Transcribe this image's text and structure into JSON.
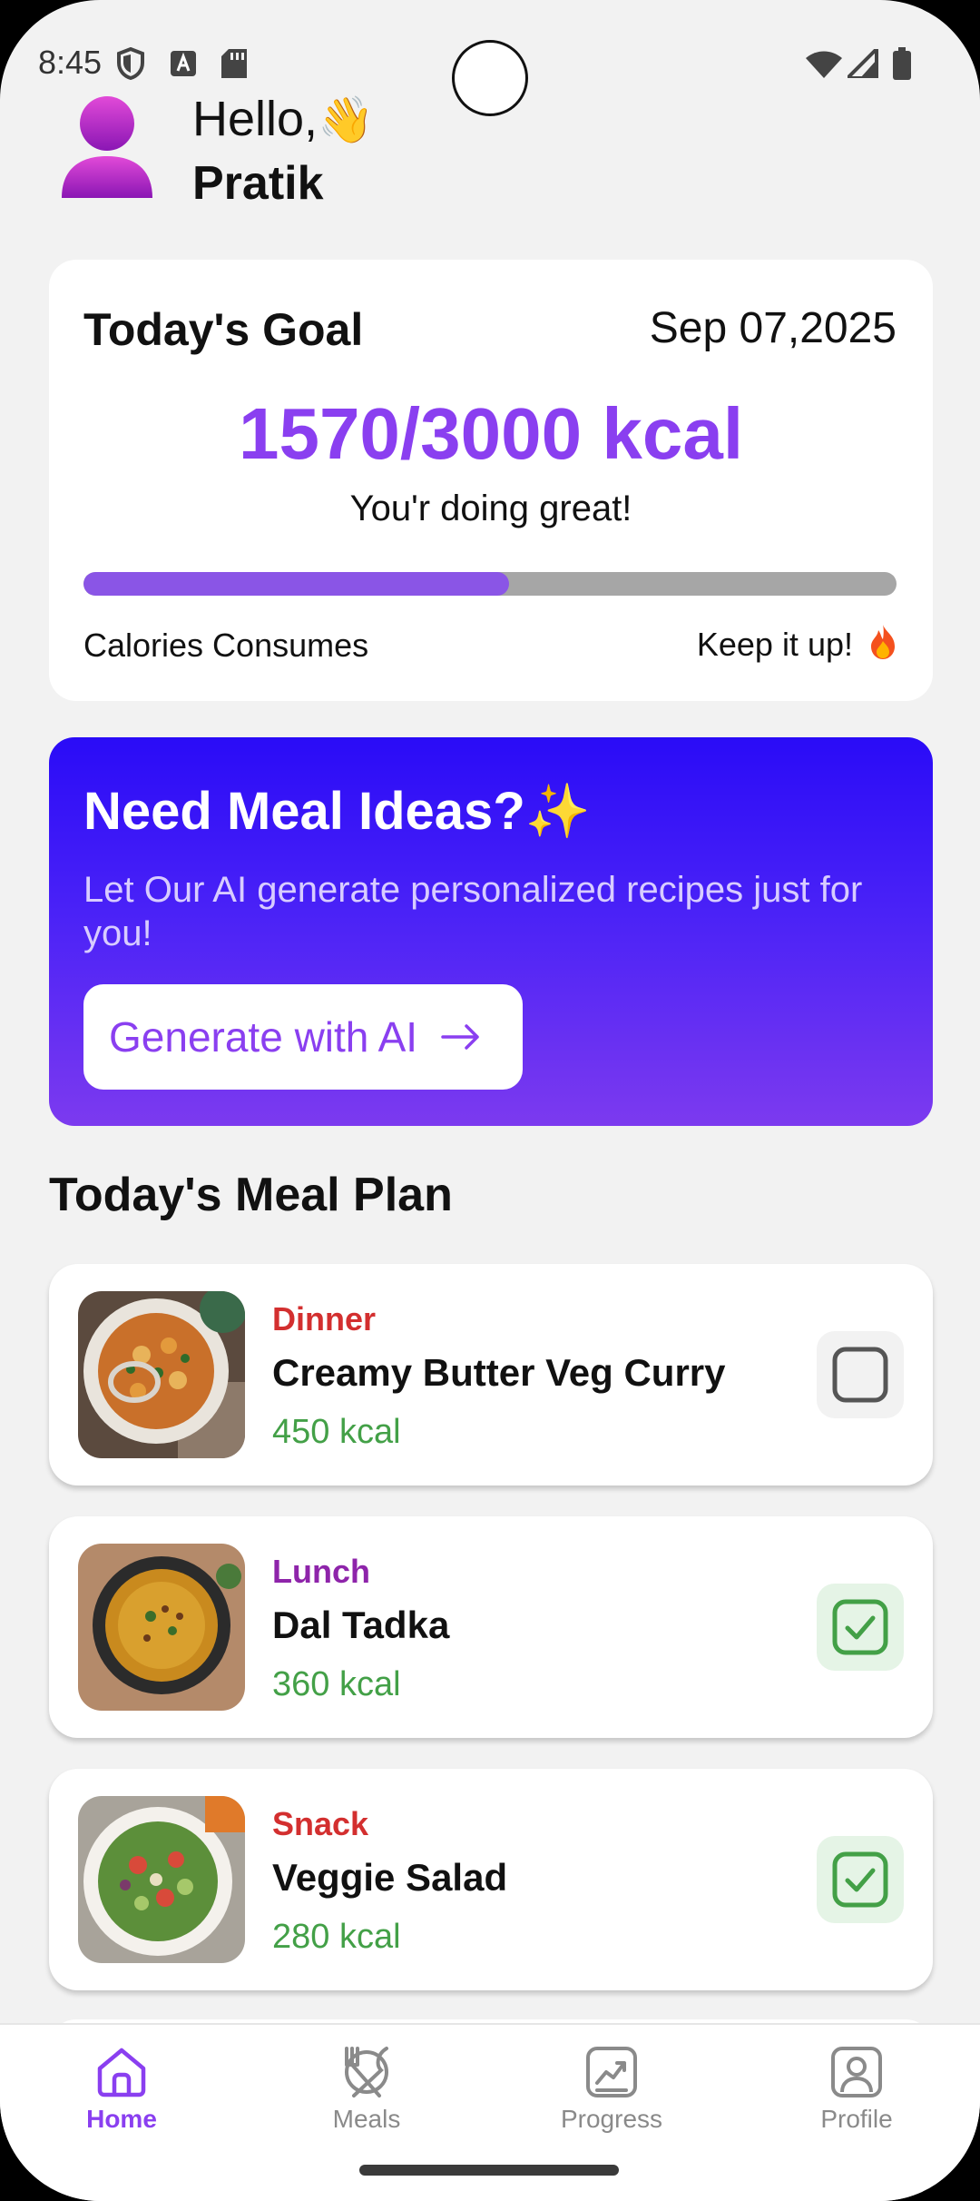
{
  "status_bar": {
    "time": "8:45",
    "icons": [
      "shield-icon",
      "a-icon",
      "sd-card-icon",
      "wifi-icon",
      "signal-icon",
      "battery-icon"
    ]
  },
  "header": {
    "greeting": "Hello,",
    "wave_emoji": "👋",
    "username": "Pratik"
  },
  "goal_card": {
    "title": "Today's Goal",
    "date": "Sep 07,2025",
    "kcal_text": "1570/3000 kcal",
    "message": "You'r doing great!",
    "progress_fraction": 0.5233,
    "left_label": "Calories Consumes",
    "right_label": "Keep it up!",
    "right_icon": "fire-icon"
  },
  "ai_card": {
    "title": "Need Meal Ideas?",
    "sparkle": "✨",
    "subtitle": "Let Our AI generate personalized recipes just for you!",
    "button_label": "Generate with AI",
    "button_icon": "arrow-right-icon"
  },
  "meal_plan": {
    "title": "Today's Meal Plan",
    "meals": [
      {
        "type": "Dinner",
        "type_color": "#d32f2f",
        "name": "Creamy Butter Veg Curry",
        "kcal": "450 kcal",
        "checked": false
      },
      {
        "type": "Lunch",
        "type_color": "#8e24aa",
        "name": "Dal Tadka",
        "kcal": "360 kcal",
        "checked": true
      },
      {
        "type": "Snack",
        "type_color": "#d32f2f",
        "name": "Veggie Salad",
        "kcal": "280 kcal",
        "checked": true
      }
    ]
  },
  "bottom_nav": {
    "items": [
      {
        "label": "Home",
        "icon": "home-icon",
        "active": true
      },
      {
        "label": "Meals",
        "icon": "meals-icon",
        "active": false
      },
      {
        "label": "Progress",
        "icon": "progress-icon",
        "active": false
      },
      {
        "label": "Profile",
        "icon": "profile-icon",
        "active": false
      }
    ]
  },
  "colors": {
    "accent": "#8a3ff0",
    "kcal_green": "#43a047",
    "ai_gradient_top": "#2a0bf7",
    "ai_gradient_bottom": "#7c3aef"
  }
}
